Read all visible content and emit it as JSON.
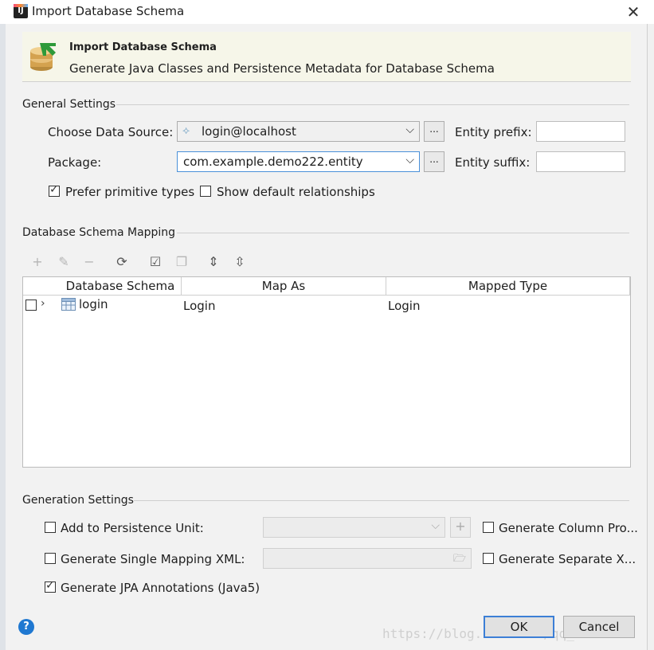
{
  "window": {
    "title": "Import Database Schema"
  },
  "banner": {
    "title": "Import Database Schema",
    "subtitle": "Generate Java Classes and Persistence Metadata for Database Schema"
  },
  "general": {
    "section": "General Settings",
    "data_source_label": "Choose Data Source:",
    "data_source_value": "login@localhost",
    "package_label": "Package:",
    "package_value": "com.example.demo222.entity",
    "ellipsis": "...",
    "entity_prefix_label": "Entity prefix:",
    "entity_prefix_value": "",
    "entity_suffix_label": "Entity suffix:",
    "entity_suffix_value": "",
    "prefer_primitive_label": "Prefer primitive types",
    "prefer_primitive_checked": true,
    "show_default_rel_label": "Show default relationships",
    "show_default_rel_checked": false
  },
  "mapping": {
    "section": "Database Schema Mapping",
    "columns": [
      "Database Schema",
      "Map As",
      "Mapped Type"
    ],
    "rows": [
      {
        "schema": "login",
        "map_as": "Login",
        "mapped_type": "Login",
        "checked": false
      }
    ]
  },
  "generation": {
    "section": "Generation Settings",
    "add_persistence_label": "Add to Persistence Unit:",
    "single_mapping_label": "Generate Single Mapping XML:",
    "jpa_annotations_label": "Generate JPA Annotations (Java5)",
    "jpa_annotations_checked": true,
    "column_props_label": "Generate Column Pro...",
    "separate_label": "Generate Separate X..."
  },
  "footer": {
    "ok_label": "OK",
    "cancel_label": "Cancel",
    "help": "?",
    "watermark": "https://blog.csdn.net/qq_40373622"
  },
  "icons": {
    "app": "intellij-icon",
    "close": "close-icon",
    "db_import": "database-import-icon"
  }
}
